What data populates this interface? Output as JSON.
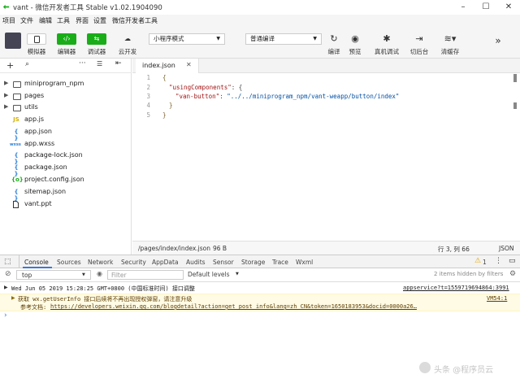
{
  "window": {
    "title": "vant - 微信开发者工具 Stable v1.02.1904090"
  },
  "menubar": {
    "items": [
      "项目",
      "文件",
      "编辑",
      "工具",
      "界面",
      "设置",
      "微信开发者工具"
    ]
  },
  "toolbar": {
    "simulator": "模拟器",
    "editor": "编辑器",
    "debugger": "调试器",
    "cloud": "云开发",
    "mode_select": "小程序模式",
    "compile_select": "普通编译",
    "compile": "编译",
    "preview": "预览",
    "device_debug": "真机调试",
    "background": "切后台",
    "clear_cache": "清缓存",
    "more": "»"
  },
  "sidebar": {
    "files": [
      {
        "name": "miniprogram_npm",
        "type": "folder"
      },
      {
        "name": "pages",
        "type": "folder"
      },
      {
        "name": "utils",
        "type": "folder"
      },
      {
        "name": "app.js",
        "type": "js",
        "badge": "JS"
      },
      {
        "name": "app.json",
        "type": "json",
        "badge": "{ }"
      },
      {
        "name": "app.wxss",
        "type": "wxss",
        "badge": "wxss"
      },
      {
        "name": "package-lock.json",
        "type": "json",
        "badge": "{ }"
      },
      {
        "name": "package.json",
        "type": "json",
        "badge": "{ }"
      },
      {
        "name": "project.config.json",
        "type": "config",
        "badge": "{o}"
      },
      {
        "name": "sitemap.json",
        "type": "json",
        "badge": "{ }"
      },
      {
        "name": "vant.ppt",
        "type": "file",
        "badge": ""
      }
    ]
  },
  "editor": {
    "tab_label": "index.json",
    "line_numbers": [
      "1",
      "2",
      "3",
      "4",
      "5"
    ],
    "lines": [
      {
        "brace": "{"
      },
      {
        "key": "\"usingComponents\"",
        "rest": ": {"
      },
      {
        "key": "\"van-button\"",
        "rest": ": ",
        "value": "\"../../miniprogram_npm/vant-weapp/button/index\""
      },
      {
        "brace": "}"
      },
      {
        "brace": "}"
      }
    ]
  },
  "statusbar": {
    "path": "/pages/index/index.json",
    "size": "96 B",
    "position": "行 3, 列 66",
    "lang": "JSON"
  },
  "devtools": {
    "tabs": [
      "Console",
      "Sources",
      "Network",
      "Security",
      "AppData",
      "Audits",
      "Sensor",
      "Storage",
      "Trace",
      "Wxml"
    ],
    "warn_count": "1",
    "context": "top",
    "filter_placeholder": "Filter",
    "levels": "Default levels",
    "hidden_info": "2 items hidden by filters",
    "log_time": "Wed Jun 05 2019 15:28:25 GMT+0800 (中国标准时间) 接口调整",
    "log_source": "appservice?t=1559719694864:3991",
    "warn_line1": "获取 wx.getUserInfo 接口后续将不再出现授权弹窗，请注意升级",
    "warn_source": "VM54:1",
    "warn_line2_prefix": "参考文档: ",
    "warn_link": "https://developers.weixin.qq.com/blogdetail?action=get_post_info&lang=zh_CN&token=1650183953&docid=0000a26…",
    "prompt": "›"
  },
  "watermark": "头条 @程序员云"
}
